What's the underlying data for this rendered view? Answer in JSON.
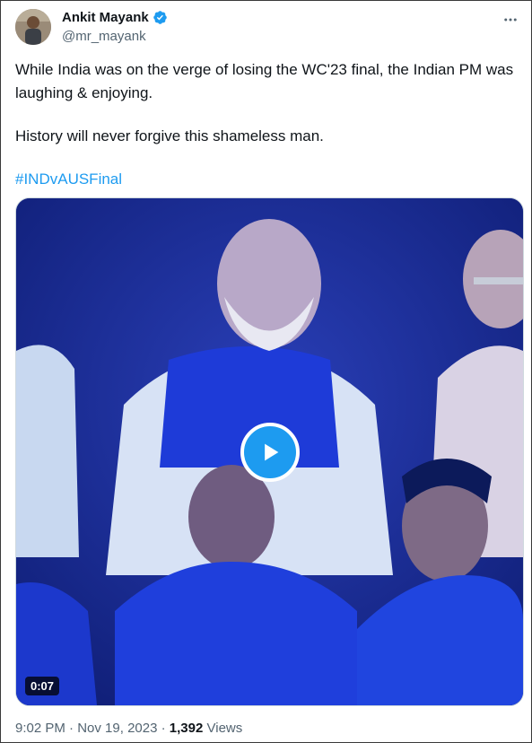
{
  "author": {
    "name": "Ankit Mayank",
    "handle": "@mr_mayank",
    "verified": true
  },
  "tweet": {
    "line1": "While India was on the verge of losing the WC'23 final, the Indian PM was laughing & enjoying.",
    "line2": "History will never forgive this shameless man.",
    "hashtag": "#INDvAUSFinal"
  },
  "media": {
    "type": "video",
    "duration": "0:07"
  },
  "meta": {
    "time": "9:02 PM",
    "separator": "·",
    "date": "Nov 19, 2023",
    "views_count": "1,392",
    "views_label": "Views"
  },
  "colors": {
    "accent": "#1d9bf0",
    "secondary_text": "#536471",
    "primary_text": "#0f1419"
  },
  "icons": [
    "avatar",
    "verified-badge-icon",
    "more-options-icon",
    "play-icon"
  ]
}
